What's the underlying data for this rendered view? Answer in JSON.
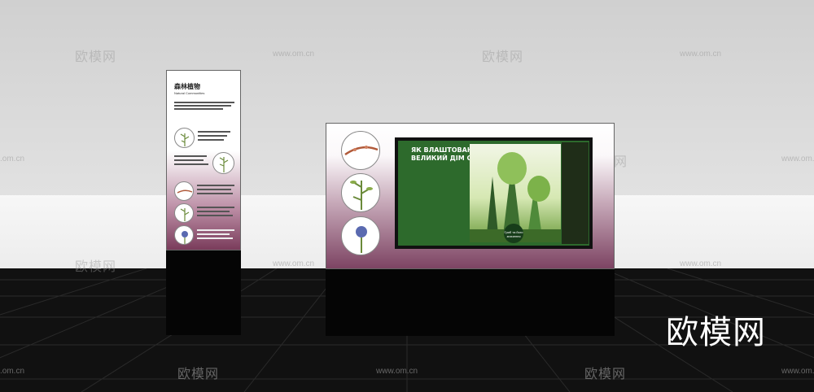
{
  "watermarks": {
    "brand_cn": "欧模网",
    "site_url": "www.om.cn",
    "site_url_short": ".om.cn",
    "corner_logo": "欧模网"
  },
  "totem": {
    "title": "森林植物",
    "subtitle": "Natural Communities"
  },
  "board": {
    "heading_line1": "ЯК ВЛАШТОВАНИЙ",
    "heading_line2": "ВЕЛИКИЙ ДІМ СУСІДІВ",
    "badge_text": "Гриб та його значення"
  },
  "colors": {
    "panel_magenta": "#7d4463",
    "screen_green": "#2d6a2c",
    "floor": "#111111"
  },
  "icons": [
    "plant-illustration-icon",
    "flower-illustration-icon",
    "tree-illustration-icon"
  ]
}
